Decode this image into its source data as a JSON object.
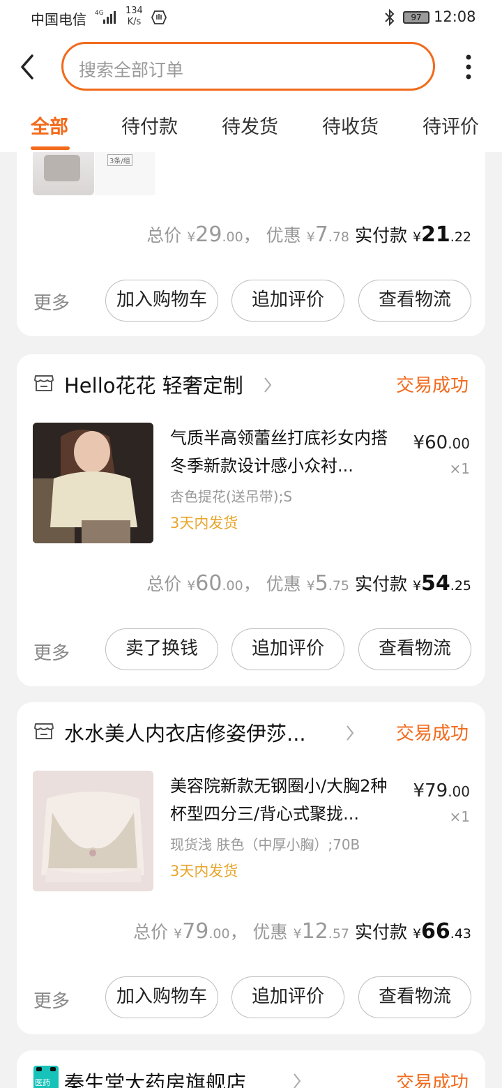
{
  "status_bar": {
    "carrier": "中国电信",
    "net_type": "4G",
    "speed_value": "134",
    "speed_unit": "K/s",
    "battery": "97",
    "time": "12:08"
  },
  "header": {
    "search_placeholder": "搜索全部订单",
    "tabs": [
      "全部",
      "待付款",
      "待发货",
      "待收货",
      "待评价"
    ],
    "active_tab": "全部"
  },
  "orders": [
    {
      "thumb_tag": "3条/组",
      "summary": {
        "total_label": "总价",
        "total_int": "29",
        "total_dec": ".00",
        "discount_label": "优惠",
        "discount_int": "7",
        "discount_dec": ".78",
        "paid_label": "实付款",
        "paid_int": "21",
        "paid_dec": ".22",
        "currency": "¥"
      },
      "more": "更多",
      "buttons": [
        "加入购物车",
        "追加评价",
        "查看物流"
      ]
    },
    {
      "shop": "Hello花花 轻奢定制",
      "status": "交易成功",
      "item": {
        "title": "气质半高领蕾丝打底衫女内搭冬季新款设计感小众衬...",
        "sku": "杏色提花(送吊带);S",
        "ship": "3天内发货",
        "price_int": "¥60",
        "price_dec": ".00",
        "qty": "×1"
      },
      "summary": {
        "total_label": "总价",
        "total_int": "60",
        "total_dec": ".00",
        "discount_label": "优惠",
        "discount_int": "5",
        "discount_dec": ".75",
        "paid_label": "实付款",
        "paid_int": "54",
        "paid_dec": ".25",
        "currency": "¥"
      },
      "more": "更多",
      "buttons": [
        "卖了换钱",
        "追加评价",
        "查看物流"
      ]
    },
    {
      "shop": "水水美人内衣店修姿伊莎...",
      "status": "交易成功",
      "item": {
        "title": "美容院新款无钢圈小/大胸2种杯型四分三/背心式聚拢...",
        "sku": "现货浅 肤色（中厚小胸）;70B",
        "ship": "3天内发货",
        "price_int": "¥79",
        "price_dec": ".00",
        "qty": "×1"
      },
      "summary": {
        "total_label": "总价",
        "total_int": "79",
        "total_dec": ".00",
        "discount_label": "优惠",
        "discount_int": "12",
        "discount_dec": ".57",
        "paid_label": "实付款",
        "paid_int": "66",
        "paid_dec": ".43",
        "currency": "¥"
      },
      "more": "更多",
      "buttons": [
        "加入购物车",
        "追加评价",
        "查看物流"
      ]
    },
    {
      "shop": "秦生堂大药房旗舰店",
      "status": "交易成功",
      "logo_text": "医药"
    }
  ]
}
